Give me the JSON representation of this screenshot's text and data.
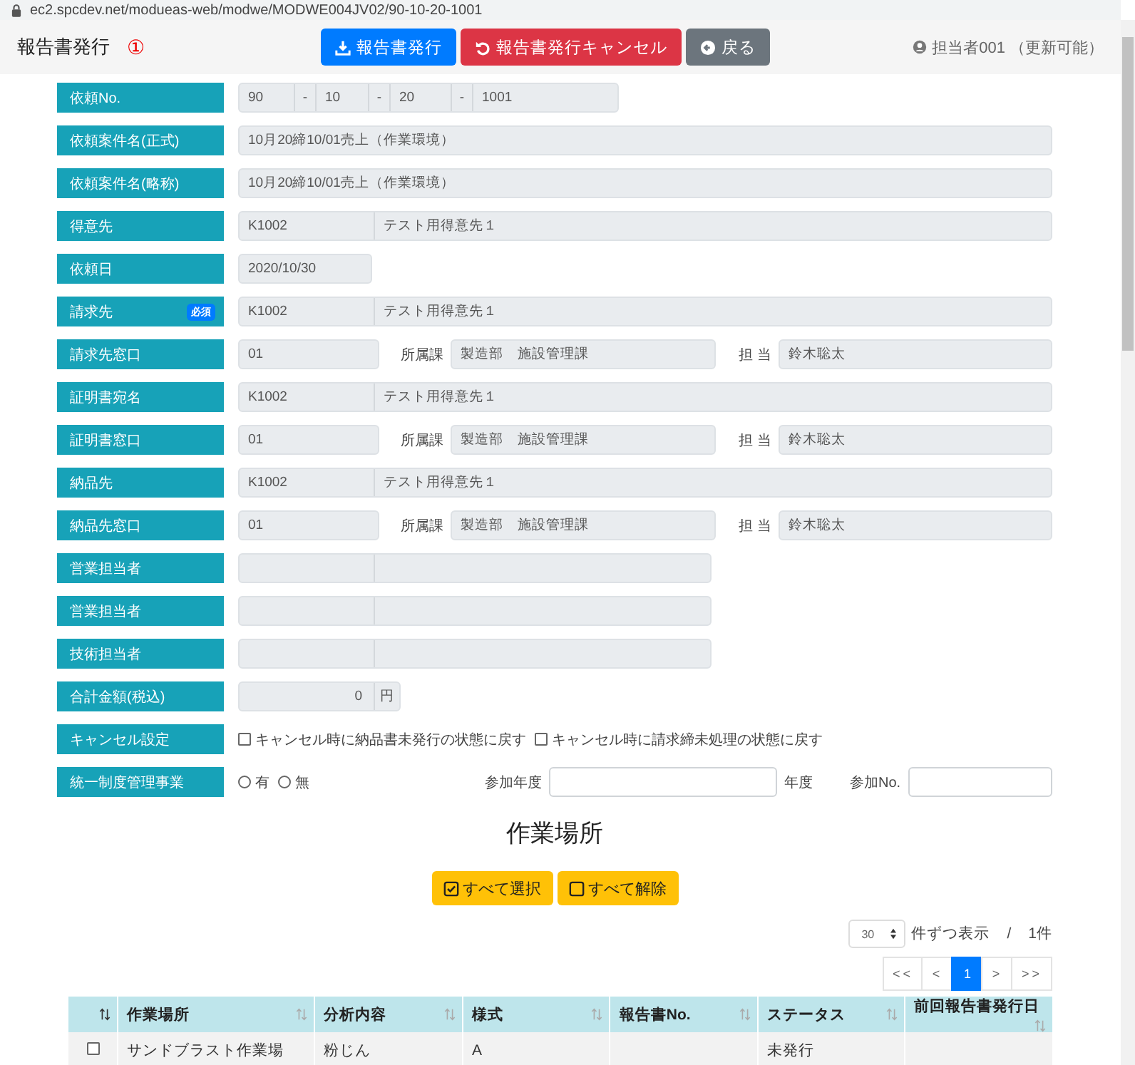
{
  "url": "ec2.spcdev.net/modueas-web/modwe/MODWE004JV02/90-10-20-1001",
  "header": {
    "title": "報告書発行",
    "marker": "①",
    "user": "担当者001 （更新可能）",
    "buttons": [
      {
        "label": "報告書発行",
        "kind": "download"
      },
      {
        "label": "報告書発行キャンセル",
        "kind": "undo"
      },
      {
        "label": "戻る",
        "kind": "back"
      }
    ]
  },
  "form": [
    {
      "kind": "segments",
      "label": "依頼No.",
      "values": [
        "90",
        "10",
        "20",
        "1001"
      ],
      "separators": [
        "-",
        "-",
        "-"
      ]
    },
    {
      "kind": "text",
      "label": "依頼案件名(正式)",
      "value": "10月20締10/01売上（作業環境）"
    },
    {
      "kind": "text",
      "label": "依頼案件名(略称)",
      "value": "10月20締10/01売上（作業環境）"
    },
    {
      "kind": "code_name",
      "label": "得意先",
      "code": "K1002",
      "name": "テスト用得意先１"
    },
    {
      "kind": "short",
      "label": "依頼日",
      "value": "2020/10/30"
    },
    {
      "kind": "code_name",
      "label": "請求先",
      "badge": "必須",
      "code": "K1002",
      "name": "テスト用得意先１"
    },
    {
      "kind": "contact",
      "label": "請求先窓口",
      "value": "01",
      "dept_label": "所属課",
      "dept": "製造部　施設管理課",
      "person_label": "担 当",
      "person": "鈴木聡太"
    },
    {
      "kind": "code_name",
      "label": "証明書宛名",
      "code": "K1002",
      "name": "テスト用得意先１"
    },
    {
      "kind": "contact",
      "label": "証明書窓口",
      "value": "01",
      "dept_label": "所属課",
      "dept": "製造部　施設管理課",
      "person_label": "担 当",
      "person": "鈴木聡太"
    },
    {
      "kind": "code_name",
      "label": "納品先",
      "code": "K1002",
      "name": "テスト用得意先１"
    },
    {
      "kind": "contact",
      "label": "納品先窓口",
      "value": "01",
      "dept_label": "所属課",
      "dept": "製造部　施設管理課",
      "person_label": "担 当",
      "person": "鈴木聡太"
    },
    {
      "kind": "empty_pair",
      "label": "営業担当者"
    },
    {
      "kind": "empty_pair",
      "label": "営業担当者"
    },
    {
      "kind": "empty_pair",
      "label": "技術担当者"
    },
    {
      "kind": "amount",
      "label": "合計金額(税込)",
      "value": "0",
      "unit": "円"
    },
    {
      "kind": "checkboxes",
      "label": "キャンセル設定",
      "options": [
        {
          "label": "キャンセル時に納品書未発行の状態に戻す",
          "checked": false
        },
        {
          "label": "キャンセル時に請求締未処理の状態に戻す",
          "checked": false
        }
      ]
    },
    {
      "kind": "radios",
      "label": "統一制度管理事業",
      "options": [
        {
          "label": "有",
          "selected": false
        },
        {
          "label": "無",
          "selected": false
        }
      ],
      "year_label": "参加年度",
      "year_suffix": "年度",
      "no_label": "参加No."
    }
  ],
  "section": {
    "title": "作業場所",
    "buttons": [
      {
        "label": "すべて選択",
        "kind": "check"
      },
      {
        "label": "すべて解除",
        "kind": "uncheck"
      }
    ],
    "page_size": "30",
    "page_size_suffix": "件ずつ表示",
    "separator": "/",
    "total": "1件",
    "pagination": [
      {
        "label": "<<",
        "selected": false
      },
      {
        "label": "<",
        "selected": false
      },
      {
        "label": "1",
        "selected": true
      },
      {
        "label": ">",
        "selected": false
      },
      {
        "label": ">>",
        "selected": false
      }
    ],
    "table": {
      "columns": [
        "作業場所",
        "分析内容",
        "様式",
        "報告書No.",
        "ステータス",
        "前回報告書発行日"
      ],
      "rows": [
        {
          "checked": false,
          "cells": [
            "サンドブラスト作業場",
            "粉じん",
            "A",
            null,
            "未発行",
            null
          ]
        }
      ]
    }
  }
}
